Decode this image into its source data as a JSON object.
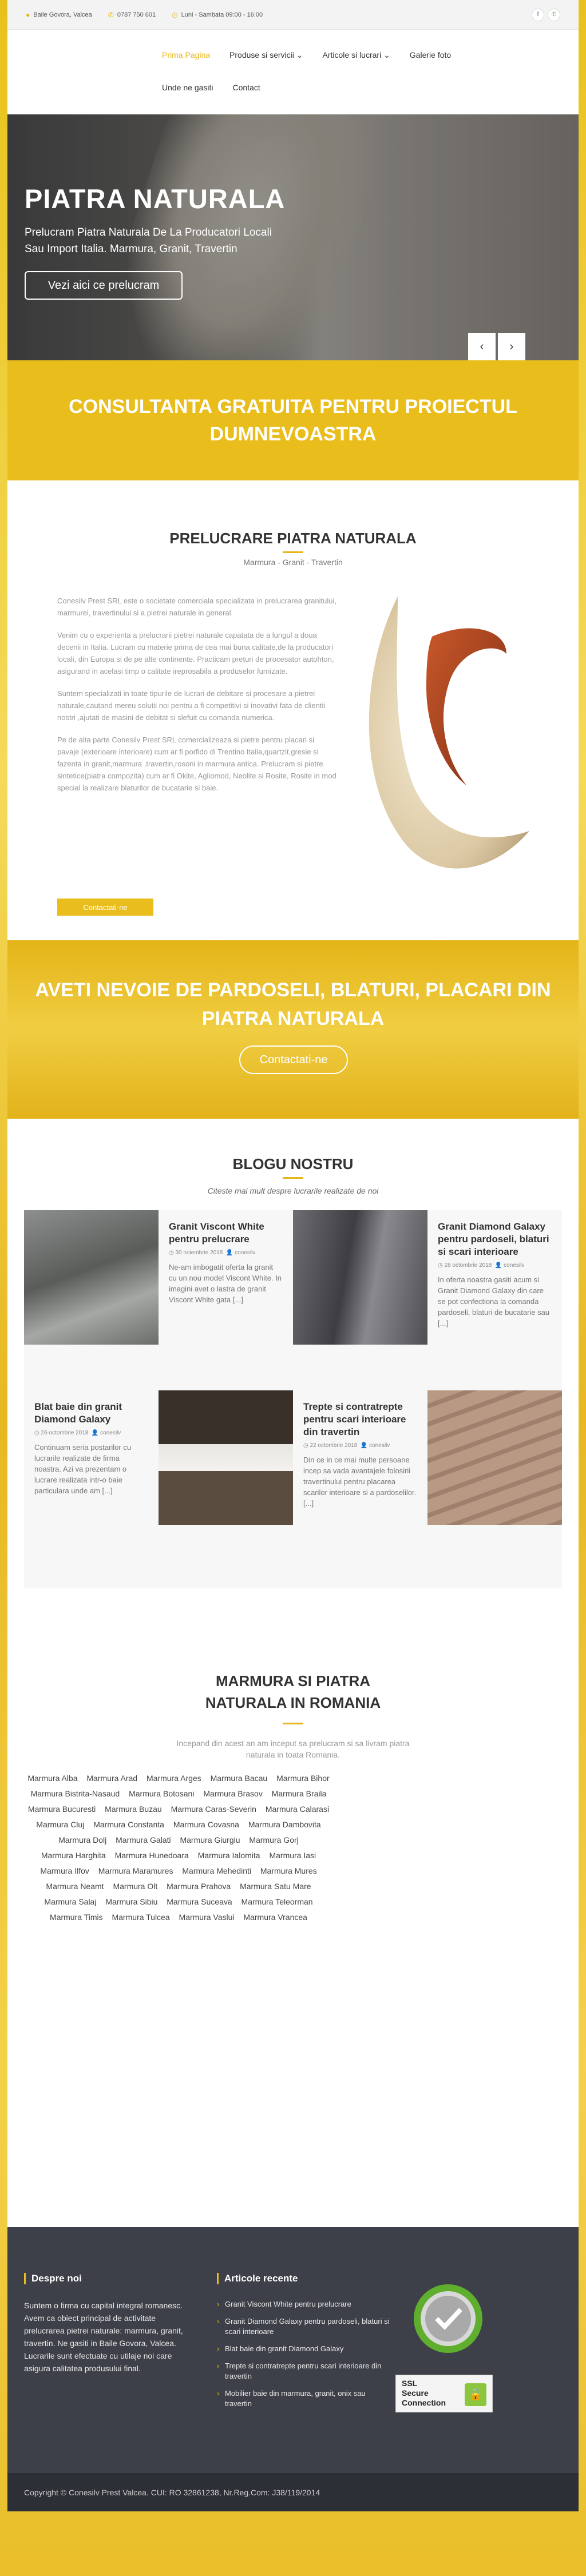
{
  "topbar": {
    "address": "Baile Govora, Valcea",
    "phone": "0787 750 601",
    "hours": "Luni - Sambata 09:00 - 16:00",
    "social": [
      "facebook-icon",
      "whatsapp-icon"
    ]
  },
  "nav": {
    "items": [
      {
        "label": "Prima Pagina",
        "active": true
      },
      {
        "label": "Produse si servicii ⌄",
        "active": false
      },
      {
        "label": "Articole si lucrari ⌄",
        "active": false
      },
      {
        "label": "Galerie foto",
        "active": false
      },
      {
        "label": "Unde ne gasiti",
        "active": false
      },
      {
        "label": "Contact",
        "active": false
      }
    ]
  },
  "hero": {
    "title": "PIATRA NATURALA",
    "text": "Prelucram Piatra Naturala De La Producatori Locali Sau Import Italia. Marmura, Granit, Travertin",
    "button": "Vezi aici ce prelucram",
    "prev": "‹",
    "next": "›"
  },
  "consult": {
    "title": "CONSULTANTA GRATUITA PENTRU PROIECTUL DUMNEVOASTRA"
  },
  "prelucrare": {
    "title": "PRELUCRARE PIATRA NATURALA",
    "subtitle": "Marmura - Granit - Travertin",
    "paragraphs": [
      "Conesilv Prest SRL este o societate comerciala specializata in prelucrarea granitului, marmurei, travertinului si a pietrei naturale in general.",
      "Venim cu o experienta a prelucrarii pietrei naturale capatata de a lungul a doua decenii in Italia. Lucram cu materie prima de cea mai buna calitate,de la producatori locali, din Europa si de pe alte continente. Practicam preturi de procesator autohton, asigurand in acelasi timp o calitate ireprosabila a produselor furnizate.",
      "Suntem specializati in toate tipurile de lucrari de debitare si procesare a pietrei naturale,cautand mereu solutii noi pentru a fi competitivi si inovativi fata de clientii nostri ,ajutati de masini de debitat si slefuit cu comanda numerica.",
      "Pe de alta parte Conesilv Prest SRL comercializeaza si pietre pentru placari si pavaje (exterioare interioare) cum ar fi porfido di Trentino Italia,quartzit,gresie si fazenta in granit,marmura ,travertin,rosoni in marmura antica. Prelucram si pietre sintetice(piatra compozita) cum ar fi Okite, Agliomod, Neolite si Rosite, Rosite in mod special la realizare blaturilor de bucatarie si baie."
    ],
    "button": "Contactati-ne"
  },
  "cta": {
    "title": "AVETI NEVOIE DE PARDOSELI, BLATURI, PLACARI DIN PIATRA NATURALA",
    "button": "Contactati-ne"
  },
  "blog": {
    "title": "BLOGU NOSTRU",
    "subtitle": "Citeste mai mult despre lucrarile realizate de noi",
    "posts": [
      {
        "title": "Granit Viscont White pentru prelucrare",
        "date": "30 noiembrie 2018",
        "author": "conesilv",
        "excerpt": "Ne-am imbogatit oferta la granit cu un nou model Viscont White. In imagini avet o lastra de granit Viscont White gata [...]"
      },
      {
        "title": "Granit Diamond Galaxy pentru pardoseli, blaturi si scari interioare",
        "date": "28 octombrie 2018",
        "author": "conesilv",
        "excerpt": "In oferta noastra gasiti acum si Granit Diamond Galaxy din care se pot confectiona la comanda pardoseli, blaturi de bucatarie sau [...]"
      },
      {
        "title": "Blat baie din granit Diamond Galaxy",
        "date": "26 octombrie 2018",
        "author": "conesilv",
        "excerpt": "Continuam seria postarilor cu lucrarile realizate de firma noastra. Azi va prezentam o lucrare realizata intr-o baie particulara unde am [...]"
      },
      {
        "title": "Trepte si contratrepte pentru scari interioare din travertin",
        "date": "22 octombrie 2018",
        "author": "conesilv",
        "excerpt": "Din ce in ce mai multe persoane incep sa vada avantajele folosirii travertinului pentru placarea scarilor interioare si a pardoselilor. [...]"
      }
    ]
  },
  "marmura": {
    "title": "MARMURA SI PIATRA NATURALA IN ROMANIA",
    "subtitle": "Incepand din acest an am inceput sa prelucram si sa livram piatra naturala in toata Romania.",
    "tags": [
      "Marmura Alba",
      "Marmura Arad",
      "Marmura Arges",
      "Marmura Bacau",
      "Marmura Bihor",
      "Marmura Bistrita-Nasaud",
      "Marmura Botosani",
      "Marmura Brasov",
      "Marmura Braila",
      "Marmura Bucuresti",
      "Marmura Buzau",
      "Marmura Caras-Severin",
      "Marmura Calarasi",
      "Marmura Cluj",
      "Marmura Constanta",
      "Marmura Covasna",
      "Marmura Dambovita",
      "Marmura Dolj",
      "Marmura Galati",
      "Marmura Giurgiu",
      "Marmura Gorj",
      "Marmura Harghita",
      "Marmura Hunedoara",
      "Marmura Ialomita",
      "Marmura Iasi",
      "Marmura Ilfov",
      "Marmura Maramures",
      "Marmura Mehedinti",
      "Marmura Mures",
      "Marmura Neamt",
      "Marmura Olt",
      "Marmura Prahova",
      "Marmura Satu Mare",
      "Marmura Salaj",
      "Marmura Sibiu",
      "Marmura Suceava",
      "Marmura Teleorman",
      "Marmura Timis",
      "Marmura Tulcea",
      "Marmura Vaslui",
      "Marmura Vrancea"
    ]
  },
  "footer": {
    "about_title": "Despre noi",
    "about": "Suntem o firma cu capital integral romanesc. Avem ca obiect principal de activitate prelucrarea pietrei naturale: marmura, granit, travertin. Ne gasiti in Baile Govora, Valcea. Lucrarile sunt efectuate cu utilaje noi care asigura calitatea produsului final.",
    "recent_title": "Articole recente",
    "recent": [
      "Granit Viscont White pentru prelucrare",
      "Granit Diamond Galaxy pentru pardoseli, blaturi si scari interioare",
      "Blat baie din granit Diamond Galaxy",
      "Trepte si contratrepte pentru scari interioare din travertin",
      "Mobilier baie din marmura, granit, onix sau travertin"
    ],
    "ssl_line1": "SSL",
    "ssl_line2": "Secure",
    "ssl_line3": "Connection",
    "copyright": "Copyright © Conesilv Prest Valcea. CUI: RO 32861238, Nr.Reg.Com: J38/119/2014"
  },
  "colors": {
    "accent": "#e9bd1c",
    "footer": "#3d4048",
    "copyright": "#2d2f36"
  }
}
